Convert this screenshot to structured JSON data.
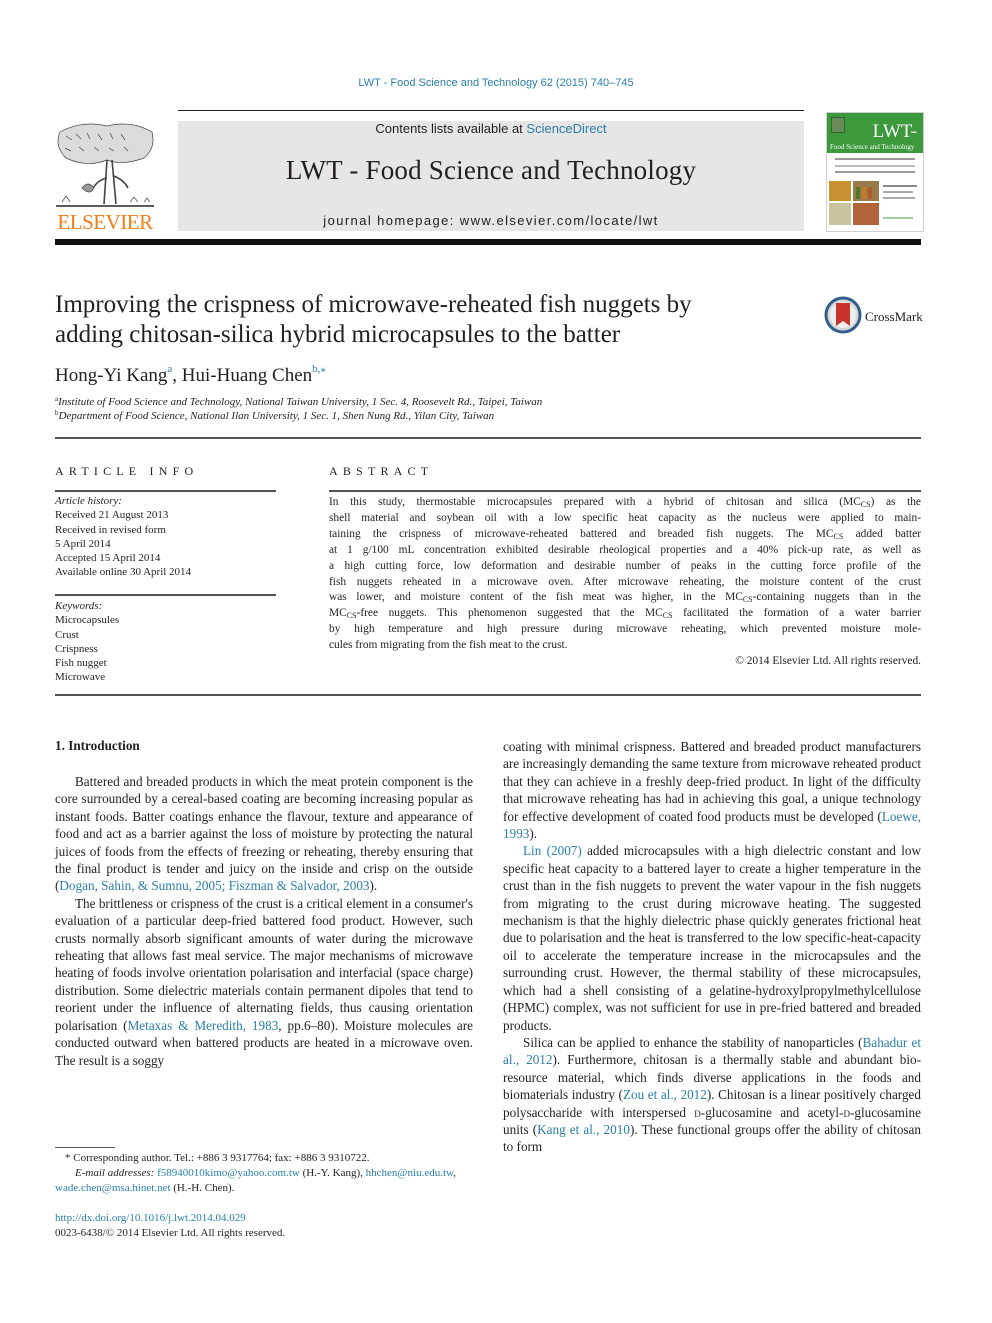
{
  "header": {
    "journal_reference": "LWT - Food Science and Technology 62 (2015) 740–745",
    "contents_prefix": "Contents lists available at ",
    "contents_link": "ScienceDirect",
    "journal_title": "LWT - Food Science and Technology",
    "homepage": "journal homepage: www.elsevier.com/locate/lwt",
    "publisher_logo_text": "ELSEVIER",
    "cover": {
      "title": "LWT-",
      "subtitle": "Food Science and Technology"
    },
    "colors": {
      "link": "#2a7fa8",
      "elsevier_orange": "#f07d16",
      "cover_green": "#3c9a3c",
      "banner_gray": "#e6e6e6"
    }
  },
  "article": {
    "title_line1": "Improving the crispness of microwave-reheated fish nuggets by",
    "title_line2": "adding chitosan-silica hybrid microcapsules to the batter",
    "crossmark_label": "CrossMark",
    "authors": [
      {
        "name": "Hong-Yi Kang",
        "sup": "a"
      },
      {
        "name": "Hui-Huang Chen",
        "sup": "b,⁎"
      }
    ],
    "author_separator": ", ",
    "affiliations": [
      {
        "sup": "a",
        "text": "Institute of Food Science and Technology, National Taiwan University, 1 Sec. 4, Roosevelt Rd., Taipei, Taiwan"
      },
      {
        "sup": "b",
        "text": "Department of Food Science, National Ilan University, 1 Sec. 1, Shen Nung Rd., Yilan City, Taiwan"
      }
    ]
  },
  "article_info": {
    "label": "ARTICLE INFO",
    "history_label": "Article history:",
    "history": [
      "Received 21 August 2013",
      "Received in revised form",
      "5 April 2014",
      "Accepted 15 April 2014",
      "Available online 30 April 2014"
    ],
    "keywords_label": "Keywords:",
    "keywords": [
      "Microcapsules",
      "Crust",
      "Crispness",
      "Fish nugget",
      "Microwave"
    ]
  },
  "abstract": {
    "label": "ABSTRACT",
    "lines": [
      [
        "In this study, thermostable microcapsules prepared with a hybrid of chitosan and silica (MC",
        "CS",
        ") as the"
      ],
      [
        "shell material and soybean oil with a low specific heat capacity as the nucleus were applied to main-"
      ],
      [
        "taining the crispness of microwave-reheated battered and breaded fish nuggets. The MC",
        "CS",
        " added batter"
      ],
      [
        "at 1 g/100 mL concentration exhibited desirable rheological properties and a 40% pick-up rate, as well as"
      ],
      [
        "a high cutting force, low deformation and desirable number of peaks in the cutting force profile of the"
      ],
      [
        "fish nuggets reheated in a microwave oven. After microwave reheating, the moisture content of the crust"
      ],
      [
        "was lower, and moisture content of the fish meat was higher, in the MC",
        "CS",
        "-containing nuggets than in the"
      ],
      [
        "MC",
        "CS",
        "-free nuggets. This phenomenon suggested that the MC",
        "CS",
        " facilitated the formation of a water barrier"
      ],
      [
        "by high temperature and high pressure during microwave reheating, which prevented moisture mole-"
      ],
      [
        "cules from migrating from the fish meat to the crust."
      ]
    ],
    "copyright": "© 2014 Elsevier Ltd. All rights reserved."
  },
  "introduction": {
    "heading": "1.  Introduction",
    "left_column": [
      {
        "parts": [
          {
            "t": "Battered and breaded products in which the meat protein component is the core surrounded by a cereal-based coating are becoming increasing popular as instant foods. Batter coatings enhance the flavour, texture and appearance of food and act as a barrier against the loss of moisture by protecting the natural juices of foods from the effects of freezing or reheating, thereby ensuring that the final product is tender and juicy on the inside and crisp on the outside ("
          },
          {
            "t": "Dogan, Sahin, & Sumnu, 2005; Fiszman & Salvador, 2003",
            "link": true
          },
          {
            "t": ")."
          }
        ]
      },
      {
        "parts": [
          {
            "t": "The brittleness or crispness of the crust is a critical element in a consumer's evaluation of a particular deep-fried battered food product. However, such crusts normally absorb significant amounts of water during the microwave reheating that allows fast meal service. The major mechanisms of microwave heating of foods involve orientation polarisation and interfacial (space charge) dis­tribution. Some dielectric materials contain permanent dipoles that tend to reorient under the influence of alternating fields, thus causing orientation polarisation ("
          },
          {
            "t": "Metaxas & Meredith, 1983",
            "link": true
          },
          {
            "t": ", pp.6–80). Moisture molecules are conducted outward when battered products are heated in a microwave oven. The result is a soggy"
          }
        ]
      }
    ],
    "right_column": [
      {
        "noindent": true,
        "parts": [
          {
            "t": "coating with minimal crispness. Battered and breaded product manufacturers are increasingly demanding the same texture from microwave reheated product that they can achieve in a freshly deep-fried product. In light of the difficulty that microwave reheating has had in achieving this goal, a unique technology for effective development of coated food products must be developed ("
          },
          {
            "t": "Loewe, 1993",
            "link": true
          },
          {
            "t": ")."
          }
        ]
      },
      {
        "parts": [
          {
            "t": "Lin (2007)",
            "link": true
          },
          {
            "t": " added microcapsules with a high dielectric constant and low specific heat capacity to a battered layer to create a higher temperature in the crust than in the fish nuggets to prevent the water vapour in the fish nuggets from migrating to the crust during microwave heating. The suggested mechanism is that the highly dielectric phase quickly generates frictional heat due to polarisation and the heat is transferred to the low specific-heat-capacity oil to accelerate the temperature increase in the microcapsules and the surrounding crust. However, the thermal stability of these micro­capsules, which had a shell consisting of a gelatine-hydroxylpropylmethylcellulose (HPMC) complex, was not suffi­cient for use in pre-fried battered and breaded products."
          }
        ]
      },
      {
        "parts": [
          {
            "t": "Silica can be applied to enhance the stability of nanoparticles ("
          },
          {
            "t": "Bahadur et al., 2012",
            "link": true
          },
          {
            "t": "). Furthermore, chitosan is a thermally stable and abundant bio-resource material, which finds diverse applica­tions in the foods and biomaterials industry ("
          },
          {
            "t": "Zou et al., 2012",
            "link": true
          },
          {
            "t": "). Chitosan is a linear positively charged polysaccharide with inter­spersed "
          },
          {
            "t": "d",
            "smallcaps": true
          },
          {
            "t": "-glucosamine and acetyl-"
          },
          {
            "t": "d",
            "smallcaps": true
          },
          {
            "t": "-glucosamine units ("
          },
          {
            "t": "Kang et al., 2010",
            "link": true
          },
          {
            "t": "). These functional groups offer the ability of chitosan to form"
          }
        ]
      }
    ]
  },
  "footnotes": {
    "corresponding": "* Corresponding author. Tel.: +886 3 9317764; fax: +886 3 9310722.",
    "email_label": "E-mail addresses: ",
    "email1": "f58940010kimo@yahoo.com.tw",
    "email1_owner": " (H.-Y. Kang), ",
    "email2": "hhchen@niu.edu.tw",
    "email2_sep": ", ",
    "email3": "wade.chen@msa.hinet.net",
    "email3_owner": " (H.-H. Chen).",
    "doi": "http://dx.doi.org/10.1016/j.lwt.2014.04.029",
    "issn": "0023-6438/© 2014 Elsevier Ltd. All rights reserved."
  }
}
